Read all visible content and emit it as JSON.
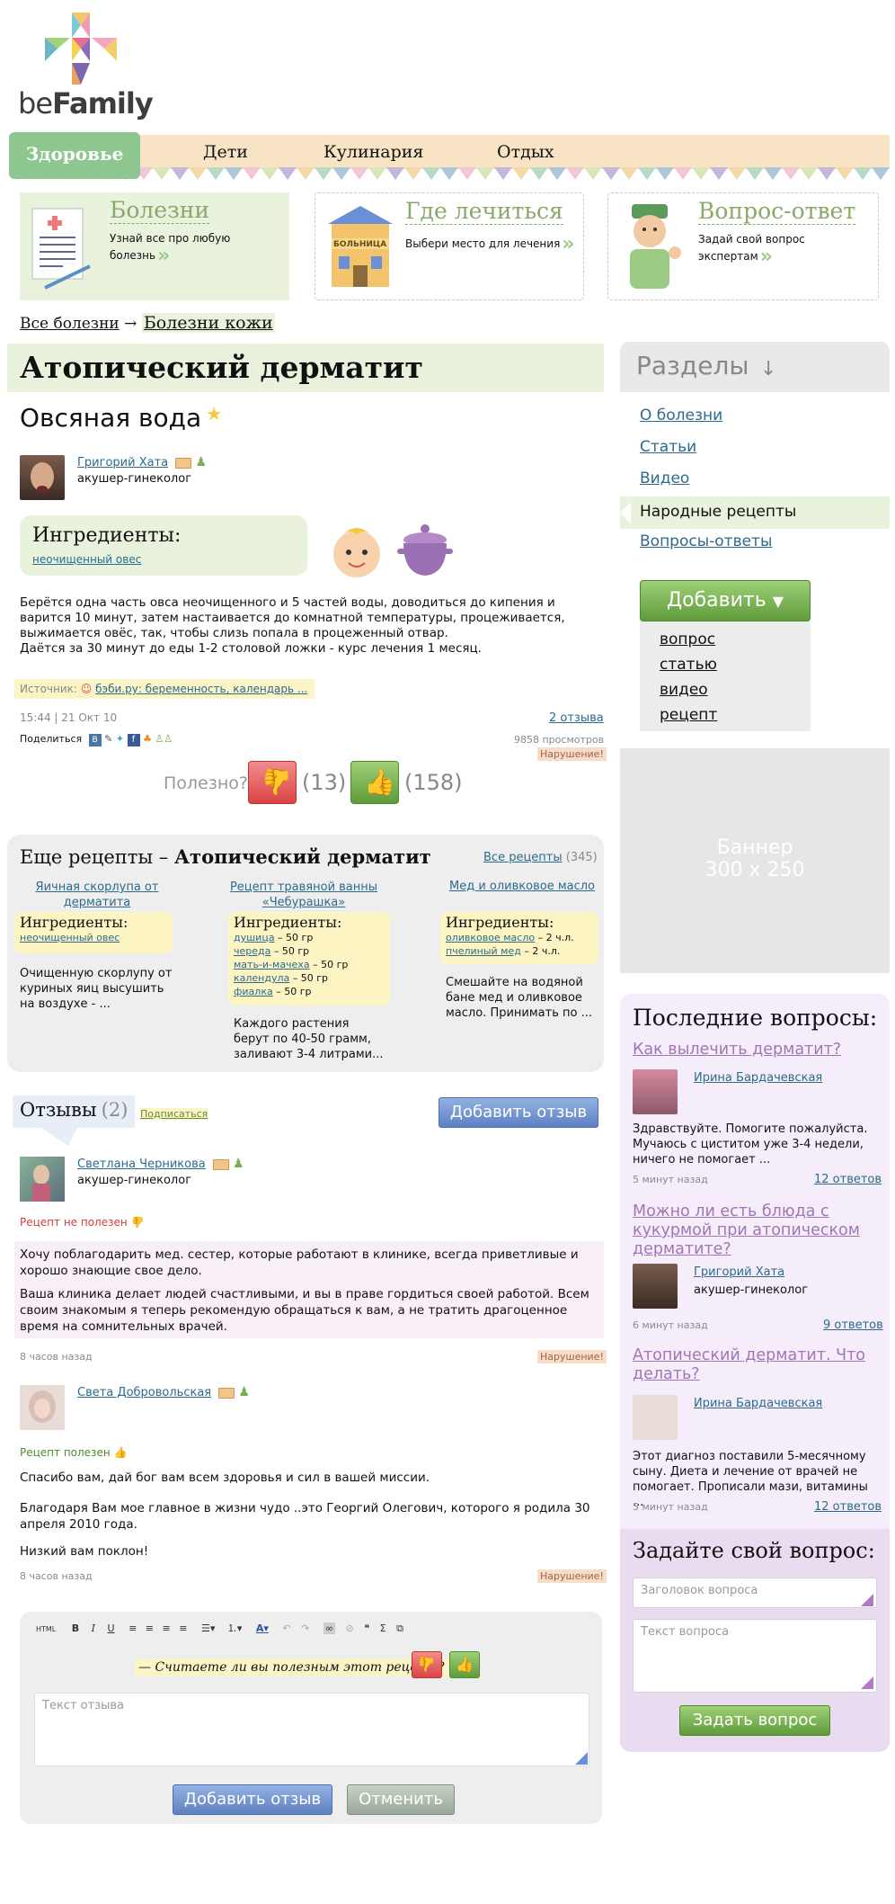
{
  "header": {
    "logo_prefix": "be",
    "logo_bold": "Family",
    "nav": {
      "active": "Здоровье",
      "items": [
        "Дети",
        "Кулинария",
        "Отдых"
      ]
    }
  },
  "promos": [
    {
      "title": "Болезни",
      "subtitle": "Узнай все про любую болезнь"
    },
    {
      "title": "Где лечиться",
      "subtitle": "Выбери место для лечения",
      "badge": "БОЛЬНИЦА"
    },
    {
      "title": "Вопрос-ответ",
      "subtitle": "Задай свой вопрос экспертам"
    }
  ],
  "breadcrumb": {
    "root": "Все болезни",
    "arrow": "→",
    "current": "Болезни кожи"
  },
  "page": {
    "title": "Атопический дерматит",
    "recipe_title": "Овсяная вода",
    "author": {
      "name": "Григорий Хата",
      "role": "акушер-гинеколог"
    },
    "ingredients_heading": "Ингредиенты:",
    "ingredients": [
      "неочищенный овес"
    ],
    "description": [
      "Берётся одна часть овса неочищенного и 5 частей воды, доводиться до кипения и варится 10 минут, затем настаивается до комнатной температуры, процеживается, выжимается овёс, так, чтобы слизь попала в процеженный отвар.",
      "Даётся за 30 минут до еды 1-2 столовой ложки - курс лечения 1 месяц."
    ],
    "source_label": "Источник:",
    "source_link": "бэби.ру: беременность, календарь ...",
    "meta_time": "15:44 | 21 Окт 10",
    "reviews_link": "2 отзыва",
    "share_label": "Поделиться",
    "views": "9858 просмотров",
    "violation": "Нарушение!",
    "useful_label": "Полезно?",
    "dislikes": "(13)",
    "likes": "(158)"
  },
  "more_recipes": {
    "heading_prefix": "Еще рецепты –",
    "heading_topic": "Атопический дерматит",
    "all_link": "Все рецепты",
    "all_count": "(345)",
    "ingredients_heading": "Ингредиенты:",
    "items": [
      {
        "title": "Яичная скорлупа от дерматита",
        "ingredients": [
          {
            "name": "неочищенный овес",
            "qty": ""
          }
        ],
        "text": "Очищенную скорлупу от куриных яиц высушить на воздухе - ..."
      },
      {
        "title": "Рецепт травяной ванны «Чебурашка»",
        "ingredients": [
          {
            "name": "душица",
            "qty": " – 50 гр"
          },
          {
            "name": "череда",
            "qty": " – 50 гр"
          },
          {
            "name": "мать-и-мачеха",
            "qty": " – 50 гр"
          },
          {
            "name": "календула",
            "qty": " – 50 гр"
          },
          {
            "name": "фиалка",
            "qty": " – 50 гр"
          }
        ],
        "text": "Каждого растения берут по 40-50 грамм, заливают 3-4 литрами..."
      },
      {
        "title": "Мед и оливковое масло",
        "ingredients": [
          {
            "name": "оливковое масло",
            "qty": " – 2 ч.л."
          },
          {
            "name": "пчелиный мед",
            "qty": " – 2 ч.л."
          }
        ],
        "text": "Смешайте на водяной бане мед и оливковое масло. Принимать по ..."
      }
    ]
  },
  "reviews": {
    "heading": "Отзывы",
    "count": "(2)",
    "subscribe": "Подписаться",
    "add_button": "Добавить отзыв",
    "items": [
      {
        "name": "Светлана Черникова",
        "role": "акушер-гинеколог",
        "verdict": "Рецепт не полезен",
        "paragraphs": [
          "Хочу поблагодарить мед. сестер, которые работают в клинике, всегда приветливые и хорошо знающие свое дело.",
          "Ваша клиника делает людей счастливыми, и вы в праве гордиться своей работой. Всем своим знакомым я теперь рекомендую обращаться к вам, а не тратить драгоценное время на сомнительных врачей."
        ],
        "time": "8 часов назад",
        "violation": "Нарушение!"
      },
      {
        "name": "Света Добровольская",
        "role": "",
        "verdict": "Рецепт полезен",
        "paragraphs": [
          "Спасибо вам, дай бог вам всем здоровья и сил в вашей миссии.",
          "Благодаря Вам мое главное в жизни чудо ..это Георгий Олегович, которого я родила 30 апреля 2010 года.",
          "Низкий вам поклон!"
        ],
        "time": "8 часов назад",
        "violation": "Нарушение!"
      }
    ]
  },
  "editor": {
    "question": "— Считаете ли вы полезным этот рецепт?",
    "placeholder": "Текст отзыва",
    "submit": "Добавить отзыв",
    "cancel": "Отменить",
    "toolbar": [
      "HTML",
      "B",
      "I",
      "U",
      "Σ"
    ]
  },
  "sidebar": {
    "heading": "Разделы",
    "heading_arrow": "↓",
    "links": [
      "О болезни",
      "Статьи",
      "Видео",
      "Народные рецепты",
      "Вопросы-ответы"
    ],
    "active_link": "Народные рецепты",
    "add_button": "Добавить",
    "add_options": [
      "вопрос",
      "статью",
      "видео",
      "рецепт"
    ],
    "banner_line1": "Баннер",
    "banner_line2": "300 x 250",
    "last_questions": {
      "heading": "Последние вопросы:",
      "items": [
        {
          "title": "Как вылечить дерматит?",
          "author": "Ирина Бардачевская",
          "role": "",
          "text": "Здравствуйте. Помогите пожалуйста. Мучаюсь с циститом уже 3-4 недели, ничего не помогает ...",
          "time": "5 минут назад",
          "answers": "12 ответов"
        },
        {
          "title": "Можно ли есть блюда с кукурмой при атопическом дерматите?",
          "author": "Григорий Хата",
          "role": "акушер-гинеколог",
          "text": "",
          "time": "6 минут назад",
          "answers": "9 ответов"
        },
        {
          "title": "Атопический дерматит. Что делать?",
          "author": "Ирина Бардачевская",
          "role": "",
          "text": "Этот диагноз поставили 5-месячному сыну. Диета и лечение от врачей не помогает. Прописали мази, витамины ...",
          "time": "5 минут назад",
          "answers": "12 ответов"
        }
      ]
    },
    "ask": {
      "heading": "Задайте свой вопрос:",
      "title_placeholder": "Заголовок вопроса",
      "text_placeholder": "Текст вопроса",
      "submit": "Задать вопрос"
    }
  }
}
